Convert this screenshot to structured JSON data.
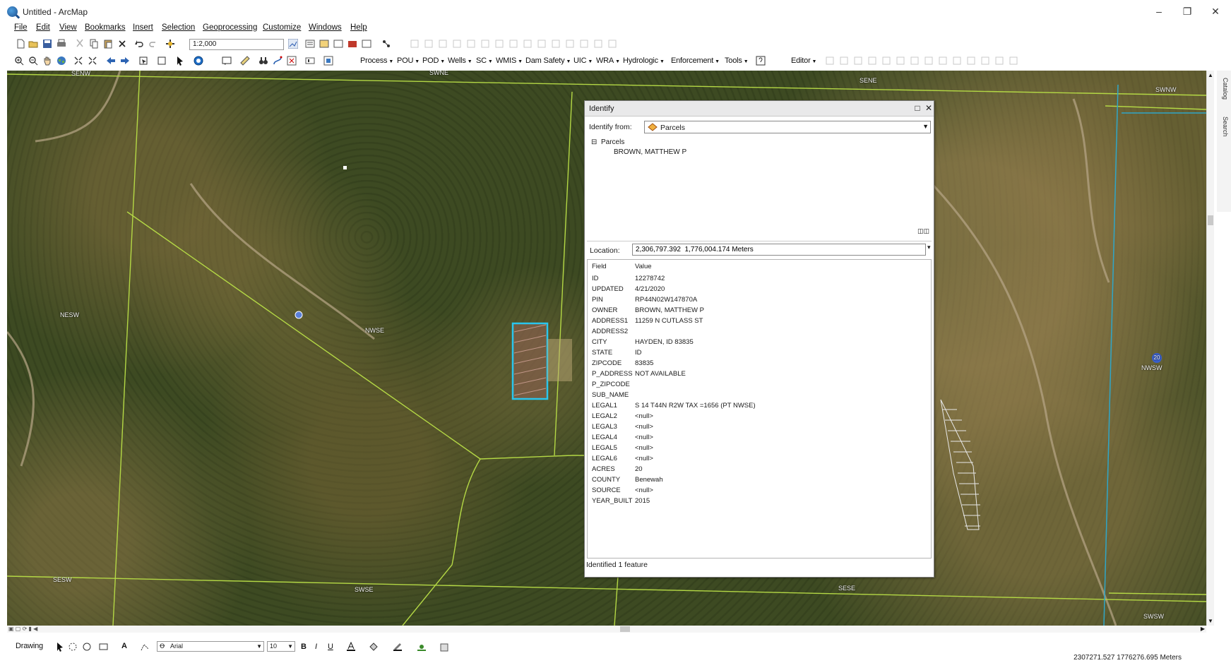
{
  "window": {
    "title": "Untitled - ArcMap",
    "minimize_label": "–",
    "restore_label": "❐",
    "close_label": "✕"
  },
  "menu": [
    "File",
    "Edit",
    "View",
    "Bookmarks",
    "Insert",
    "Selection",
    "Geoprocessing",
    "Customize",
    "Windows",
    "Help"
  ],
  "toolbar": {
    "scale": "1:2,000",
    "dropdowns": [
      "Process",
      "POU",
      "POD",
      "Wells",
      "SC",
      "WMIS",
      "Dam Safety",
      "UIC",
      "WRA",
      "Hydrologic",
      "Enforcement",
      "Tools"
    ],
    "editor_label": "Editor"
  },
  "map": {
    "labels": [
      "SENW",
      "SWNE",
      "SENE",
      "SWNW",
      "NESW",
      "NWSE",
      "NWSW",
      "SESW",
      "SWSE",
      "SESE",
      "SWSW"
    ],
    "point_labels": [
      "20"
    ],
    "selection_color": "#29c6ee",
    "parcel_line_color": "#9acd32"
  },
  "identify": {
    "title": "Identify",
    "from_label": "Identify from:",
    "from_value": "Parcels",
    "tree_root": "Parcels",
    "tree_child": "BROWN, MATTHEW P",
    "location_label": "Location:",
    "location_value": "2,306,797.392  1,776,004.174 Meters",
    "table_header": {
      "field": "Field",
      "value": "Value"
    },
    "rows": [
      {
        "field": "ID",
        "value": "12278742"
      },
      {
        "field": "UPDATED",
        "value": "4/21/2020"
      },
      {
        "field": "PIN",
        "value": "RP44N02W147870A"
      },
      {
        "field": "OWNER",
        "value": "BROWN, MATTHEW P"
      },
      {
        "field": "ADDRESS1",
        "value": "11259 N CUTLASS ST"
      },
      {
        "field": "ADDRESS2",
        "value": ""
      },
      {
        "field": "CITY",
        "value": "HAYDEN, ID 83835"
      },
      {
        "field": "STATE",
        "value": "ID"
      },
      {
        "field": "ZIPCODE",
        "value": "83835"
      },
      {
        "field": "P_ADDRESS",
        "value": "NOT AVAILABLE"
      },
      {
        "field": "P_ZIPCODE",
        "value": ""
      },
      {
        "field": "SUB_NAME",
        "value": ""
      },
      {
        "field": "LEGAL1",
        "value": "S 14 T44N R2W TAX =1656 (PT NWSE)"
      },
      {
        "field": "LEGAL2",
        "value": "<null>"
      },
      {
        "field": "LEGAL3",
        "value": "<null>"
      },
      {
        "field": "LEGAL4",
        "value": "<null>"
      },
      {
        "field": "LEGAL5",
        "value": "<null>"
      },
      {
        "field": "LEGAL6",
        "value": "<null>"
      },
      {
        "field": "ACRES",
        "value": "20"
      },
      {
        "field": "COUNTY",
        "value": "Benewah"
      },
      {
        "field": "SOURCE",
        "value": "<null>"
      },
      {
        "field": "YEAR_BUILT",
        "value": "2015"
      }
    ],
    "status": "Identified 1 feature"
  },
  "side_tabs": [
    "Catalog",
    "Search"
  ],
  "drawing": {
    "label": "Drawing",
    "font": "Arial",
    "size": "10",
    "bold": "B",
    "italic": "I",
    "underline": "U",
    "text_tool": "A"
  },
  "status": {
    "coords": "2307271.527  1776276.695 Meters"
  }
}
